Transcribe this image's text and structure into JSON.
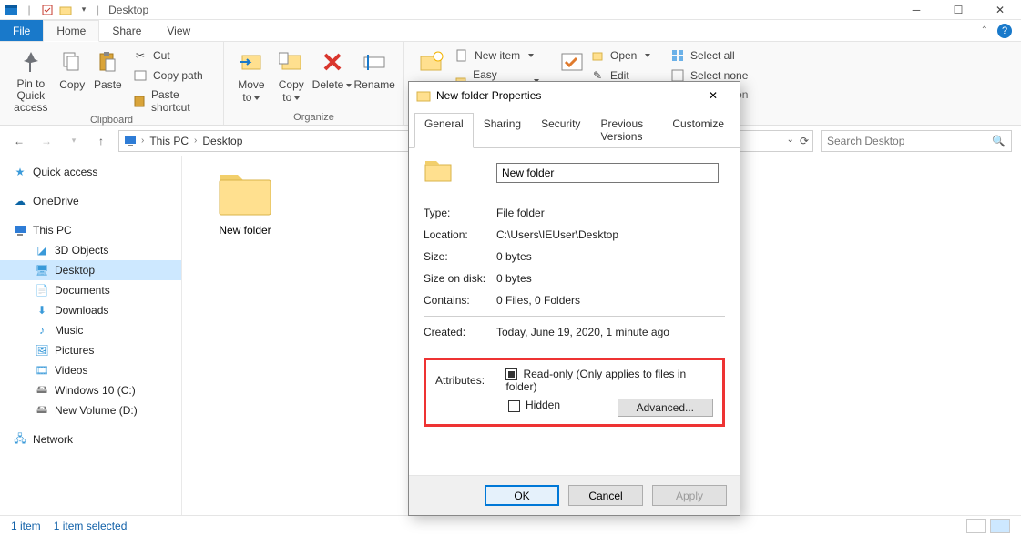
{
  "window": {
    "title": "Desktop"
  },
  "menu": {
    "file": "File",
    "home": "Home",
    "share": "Share",
    "view": "View"
  },
  "ribbon": {
    "pin": "Pin to Quick\naccess",
    "copy": "Copy",
    "paste": "Paste",
    "cut": "Cut",
    "copy_path": "Copy path",
    "paste_shortcut": "Paste shortcut",
    "move_to": "Move\nto",
    "copy_to": "Copy\nto",
    "delete": "Delete",
    "rename": "Rename",
    "new_item": "New item",
    "easy_access": "Easy access",
    "open": "Open",
    "edit": "Edit",
    "select_all": "Select all",
    "select_none": "Select none",
    "group_clipboard": "Clipboard",
    "group_organize": "Organize",
    "ection": "ection"
  },
  "addr": {
    "this_pc": "This PC",
    "desktop": "Desktop"
  },
  "search": {
    "placeholder": "Search Desktop"
  },
  "sidebar": {
    "quick_access": "Quick access",
    "onedrive": "OneDrive",
    "this_pc": "This PC",
    "objects3d": "3D Objects",
    "desktop": "Desktop",
    "documents": "Documents",
    "downloads": "Downloads",
    "music": "Music",
    "pictures": "Pictures",
    "videos": "Videos",
    "c_drive": "Windows 10 (C:)",
    "d_drive": "New Volume (D:)",
    "network": "Network"
  },
  "content": {
    "folder_name": "New folder"
  },
  "status": {
    "count": "1 item",
    "selected": "1 item selected"
  },
  "dialog": {
    "title": "New folder Properties",
    "tabs": {
      "general": "General",
      "sharing": "Sharing",
      "security": "Security",
      "prev": "Previous Versions",
      "customize": "Customize"
    },
    "name": "New folder",
    "type_l": "Type:",
    "type_v": "File folder",
    "loc_l": "Location:",
    "loc_v": "C:\\Users\\IEUser\\Desktop",
    "size_l": "Size:",
    "size_v": "0 bytes",
    "disk_l": "Size on disk:",
    "disk_v": "0 bytes",
    "contains_l": "Contains:",
    "contains_v": "0 Files, 0 Folders",
    "created_l": "Created:",
    "created_v": "Today, June 19, 2020, 1 minute ago",
    "attr_l": "Attributes:",
    "readonly": "Read-only (Only applies to files in folder)",
    "hidden": "Hidden",
    "advanced": "Advanced...",
    "ok": "OK",
    "cancel": "Cancel",
    "apply": "Apply"
  }
}
